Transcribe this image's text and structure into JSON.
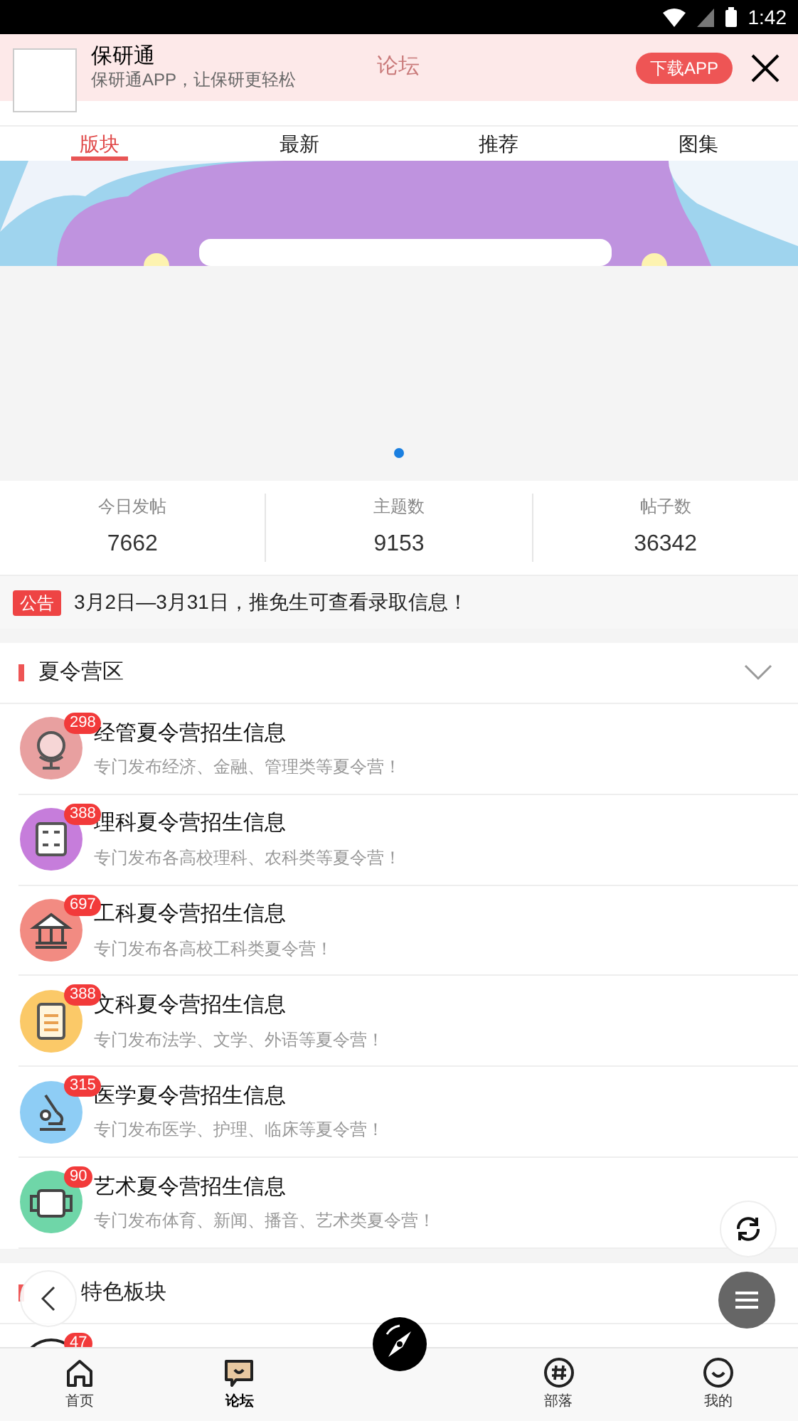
{
  "status_bar": {
    "time": "1:42"
  },
  "app_banner": {
    "name": "保研通",
    "tagline": "保研通APP，让保研更轻松",
    "download": "下载APP"
  },
  "header": {
    "title": "论坛"
  },
  "tabs": [
    {
      "label": "版块",
      "selected": true
    },
    {
      "label": "最新",
      "selected": false
    },
    {
      "label": "推荐",
      "selected": false
    },
    {
      "label": "图集",
      "selected": false
    }
  ],
  "carousel": {
    "kind": "picture",
    "dots": [
      {
        "selected": true
      }
    ]
  },
  "stats": [
    {
      "label": "今日发帖",
      "value": "7662"
    },
    {
      "label": "主题数",
      "value": "9153"
    },
    {
      "label": "帖子数",
      "value": "36342"
    }
  ],
  "notice": {
    "tag": "公告",
    "text": "3月2日—3月31日，推免生可查看录取信息！"
  },
  "sections": [
    {
      "title": "夏令营区",
      "expanded": true,
      "items": [
        {
          "name": "经管夏令营招生信息",
          "description": "专门发布经济、金融、管理类等夏令营！",
          "count": "298",
          "color": "#e8a0a0",
          "kind": "globe"
        },
        {
          "name": "理科夏令营招生信息",
          "description": "专门发布各高校理科、农科类等夏令营！",
          "count": "388",
          "color": "#c67ddb",
          "kind": "calculator"
        },
        {
          "name": "工科夏令营招生信息",
          "description": "专门发布各高校工科类夏令营！",
          "count": "697",
          "color": "#f28b82",
          "kind": "building"
        },
        {
          "name": "文科夏令营招生信息",
          "description": "专门发布法学、文学、外语等夏令营！",
          "count": "388",
          "color": "#fbc968",
          "kind": "book"
        },
        {
          "name": "医学夏令营招生信息",
          "description": "专门发布医学、护理、临床等夏令营！",
          "count": "315",
          "color": "#8ecdf5",
          "kind": "microscope"
        },
        {
          "name": "艺术夏令营招生信息",
          "description": "专门发布体育、新闻、播音、艺术类夏令营！",
          "count": "90",
          "color": "#6fd6a8",
          "kind": "frame"
        }
      ]
    },
    {
      "title": "特色板块",
      "items": [
        {
          "count": "47",
          "color": "#ffffff",
          "kind": "ring"
        }
      ]
    }
  ],
  "bottom_nav": [
    {
      "label": "首页",
      "kind": "home",
      "selected": false
    },
    {
      "label": "论坛",
      "kind": "chat",
      "selected": true
    },
    {
      "kind": "compass",
      "selected": false
    },
    {
      "label": "部落",
      "kind": "hash",
      "selected": false
    },
    {
      "label": "我的",
      "kind": "smile",
      "selected": false
    }
  ]
}
